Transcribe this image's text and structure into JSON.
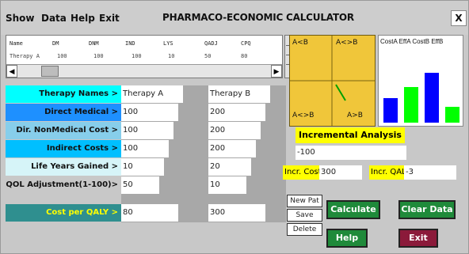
{
  "menu": {
    "show": "Show",
    "data": "Data",
    "help": "Help",
    "exit": "Exit"
  },
  "app_title": "PHARMACO-ECONOMIC CALCULATOR",
  "close_label": "X",
  "data_table": {
    "headers": [
      "Name",
      "DM",
      "DNM",
      "IND",
      "LYS",
      "QADJ",
      "CPQ"
    ],
    "row": [
      "Therapy A",
      "100",
      "100",
      "100",
      "10",
      "50",
      "80"
    ]
  },
  "rows": [
    {
      "label": "Therapy Names >",
      "a": "Therapy A",
      "b": "Therapy B",
      "color": "#00ffff"
    },
    {
      "label": "Direct Medical >",
      "a": "100",
      "b": "200",
      "color": "#1e90ff"
    },
    {
      "label": "Dir. NonMedical Cost >",
      "a": "100",
      "b": "200",
      "color": "#87ceeb"
    },
    {
      "label": "Indirect Costs >",
      "a": "100",
      "b": "200",
      "color": "#00bfff"
    },
    {
      "label": "Life Years Gained >",
      "a": "10",
      "b": "20",
      "color": "#d6f4f8"
    },
    {
      "label": "QOL Adjustment(1-100)>",
      "a": "50",
      "b": "10",
      "color": "#c8c8c8"
    },
    {
      "label": "Cost per QALY >",
      "a": "80",
      "b": "300",
      "color": "#2f8f8f"
    }
  ],
  "quadrant": {
    "top_left": "A<B",
    "top_right": "A<>B",
    "bottom_left": "A<>B",
    "bottom_right": "A>B"
  },
  "bar_chart": {
    "legend": "CostA EffA CostB EffB",
    "values": [
      35,
      50,
      70,
      22
    ],
    "colors": [
      "#0000ff",
      "#00ff00",
      "#0000ff",
      "#00ff00"
    ]
  },
  "incremental": {
    "title": "Incremental Analysis",
    "value": "-100",
    "incr_cost_label": "Incr. Cost",
    "incr_cost_value": "300",
    "incr_qaly_label": "Incr. QALY",
    "incr_qaly_value": "-3"
  },
  "buttons": {
    "new_patient": "New Pat",
    "save": "Save",
    "delete": "Delete",
    "calculate": "Calculate",
    "clear_data": "Clear Data",
    "help": "Help",
    "exit": "Exit"
  },
  "colors": {
    "yellow_highlight": "#ffff00",
    "quadrant_bg": "#f0c63a",
    "green_button": "#1f8a3a",
    "exit_button": "#8b1a3a"
  }
}
